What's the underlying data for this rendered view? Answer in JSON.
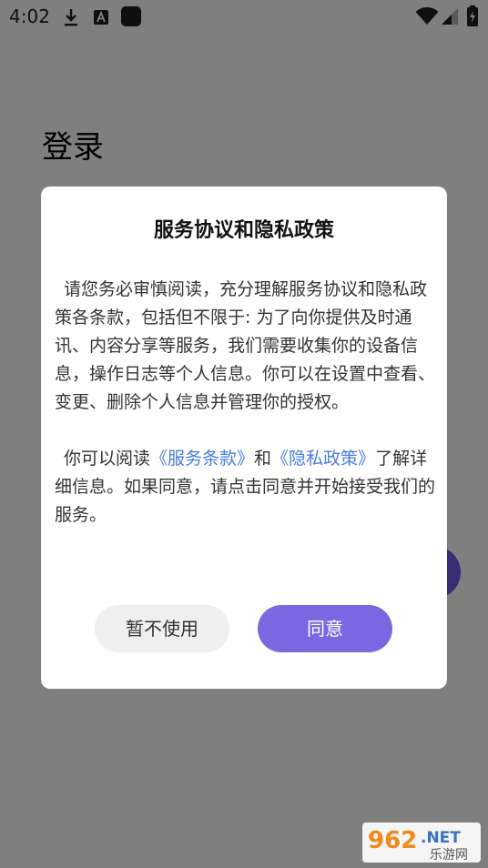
{
  "status_bar": {
    "time": "4:02"
  },
  "page": {
    "title": "登录"
  },
  "dialog": {
    "title": "服务协议和隐私政策",
    "paragraph1": "请您务必审慎阅读，充分理解服务协议和隐私政策各条款，包括但不限于: 为了向你提供及时通讯、内容分享等服务，我们需要收集你的设备信息，操作日志等个人信息。你可以在设置中查看、变更、删除个人信息并管理你的授权。",
    "paragraph2_prefix": "你可以阅读",
    "terms_link": "《服务条款》",
    "paragraph2_and": "和",
    "privacy_link": "《隐私政策》",
    "paragraph2_suffix": "了解详细信息。如果同意，请点击同意并开始接受我们的服务。",
    "decline_label": "暂不使用",
    "agree_label": "同意"
  },
  "watermark": {
    "number": "962",
    "domain": ".NET",
    "site_name": "乐游网"
  },
  "colors": {
    "accent": "#7b68e0",
    "link": "#4a7be0",
    "decline_bg": "#efefef",
    "overlay": "rgba(0,0,0,0.5)"
  }
}
